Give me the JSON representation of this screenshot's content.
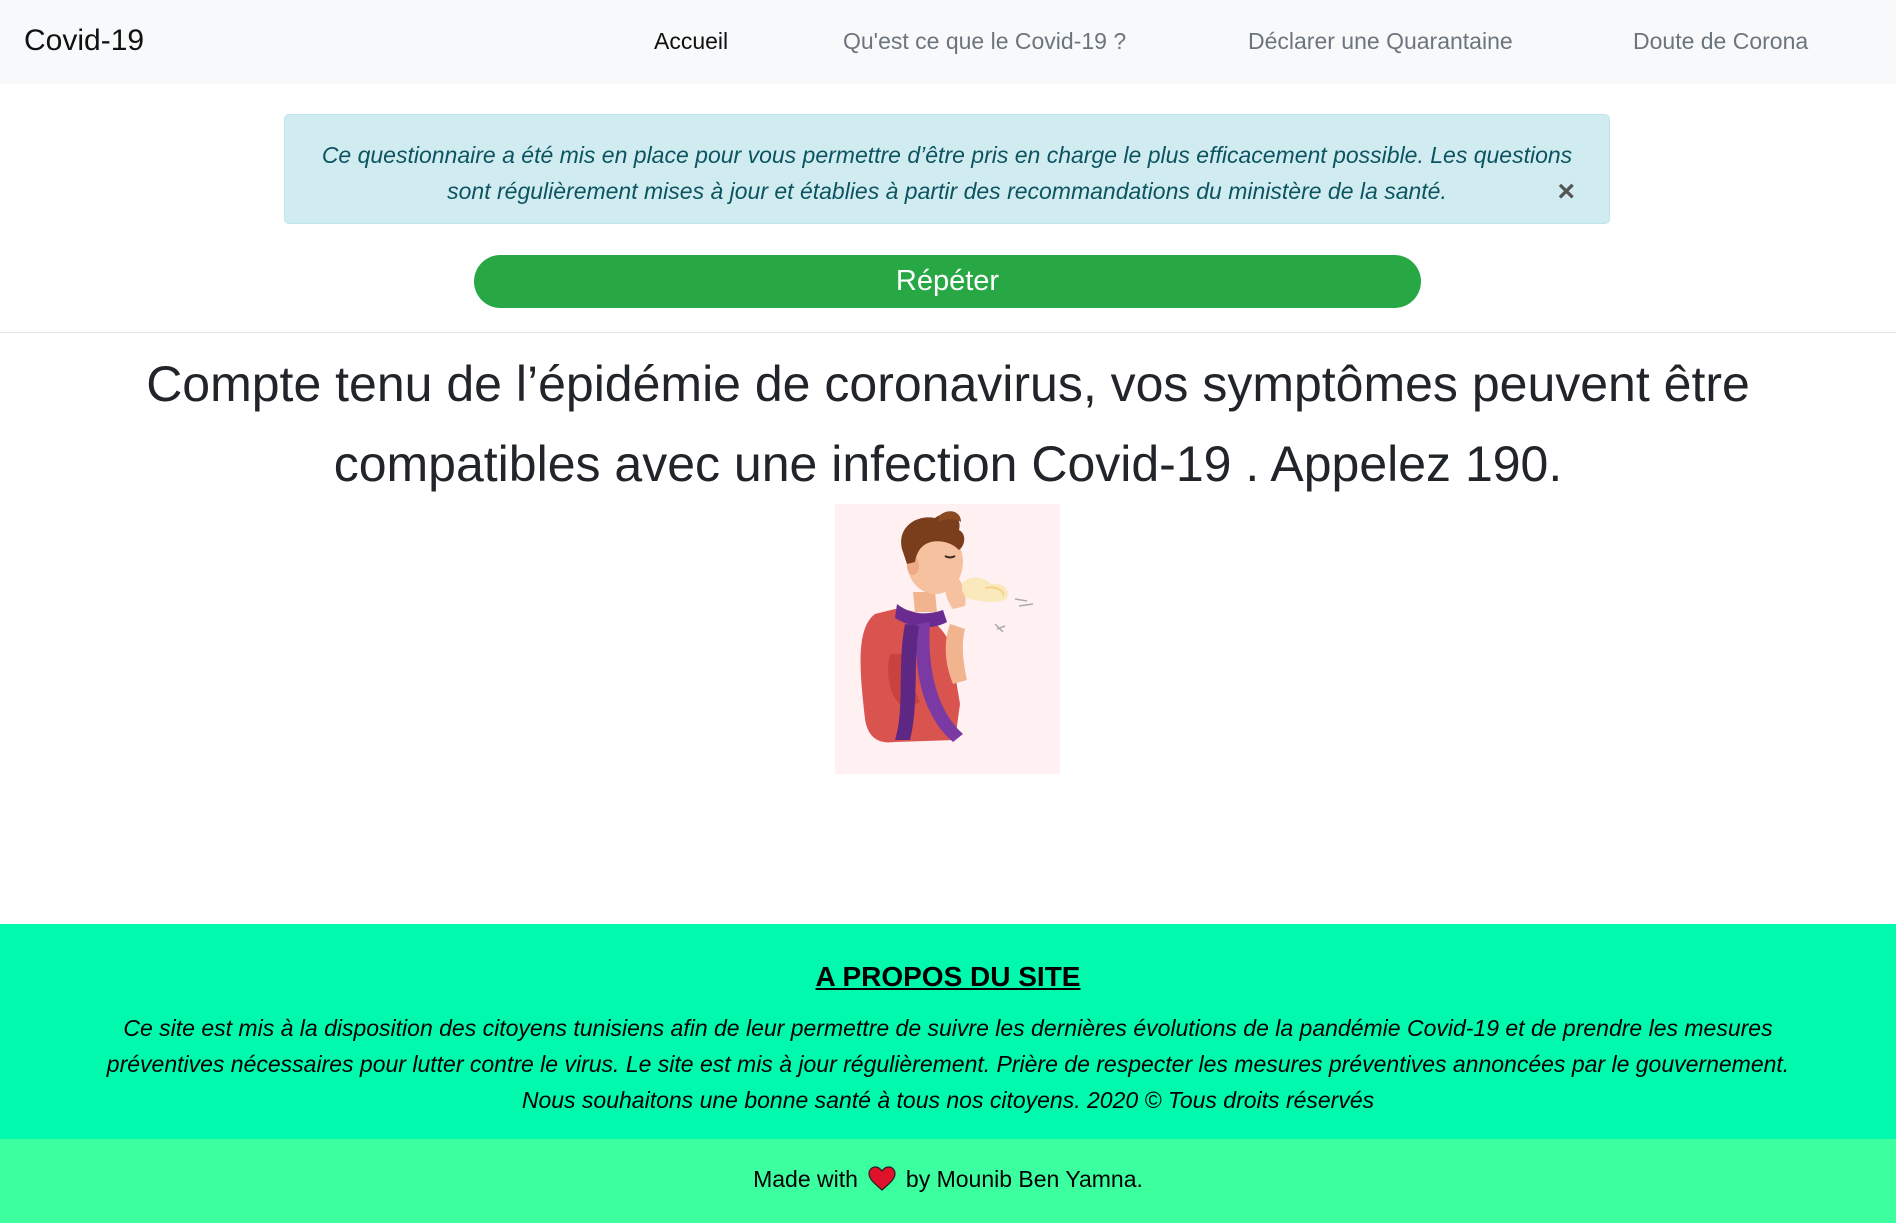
{
  "navbar": {
    "brand": "Covid-19",
    "links": [
      {
        "label": "Accueil",
        "active": true
      },
      {
        "label": "Qu'est ce que le Covid-19 ?",
        "active": false
      },
      {
        "label": "Déclarer une Quarantaine",
        "active": false
      },
      {
        "label": "Doute de Corona",
        "active": false
      }
    ]
  },
  "alert": {
    "text": "Ce questionnaire a été mis en place pour vous permettre d’être pris en charge le plus efficacement possible. Les questions sont régulièrement mises à jour et établies à partir des recommandations du ministère de la santé.",
    "close_label": "×"
  },
  "actions": {
    "repeat_label": "Répéter"
  },
  "result": {
    "message": "Compte tenu de l’épidémie de coronavirus, vos symptômes peuvent être compatibles avec une infection Covid-19 . Appelez 190."
  },
  "footer": {
    "about_title": "A PROPOS DU SITE",
    "about_text": "Ce site est mis à la disposition des citoyens tunisiens afin de leur permettre de suivre les dernières évolutions de la pandémie Covid-19 et de prendre les mesures préventives nécessaires pour lutter contre le virus. Le site est mis à jour régulièrement. Prière de respecter les mesures préventives annoncées par le gouvernement. Nous souhaitons une bonne santé à tous nos citoyens. 2020 © Tous droits réservés",
    "made_prefix": "Made with",
    "made_suffix": "by Mounib Ben Yamna."
  },
  "colors": {
    "alert_bg": "#d1ecf1",
    "button_green": "#28a745",
    "footer_about_bg": "#00f9ac",
    "footer_made_bg": "#3cff9f",
    "heart": "#e0112b"
  },
  "icons": {
    "close": "close-icon",
    "heart": "heart-icon"
  }
}
